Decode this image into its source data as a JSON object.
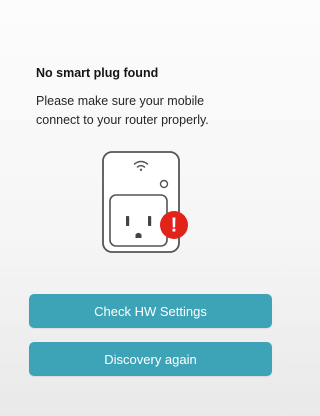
{
  "message": {
    "title": "No smart plug found",
    "line1": "Please make sure your mobile",
    "line2": "connect to your router properly."
  },
  "illustration": {
    "icons": [
      "wifi-icon",
      "smart-plug-icon",
      "error-alert-icon"
    ],
    "alert_glyph": "!",
    "plug_color": "#ffffff",
    "outline_color": "#555555",
    "alert_color": "#e2231a"
  },
  "buttons": {
    "check_hw_label": "Check HW Settings",
    "discovery_label": "Discovery again"
  },
  "colors": {
    "button_bg": "#3da4b8",
    "button_text": "#ffffff",
    "background": "#f6f6f6"
  }
}
